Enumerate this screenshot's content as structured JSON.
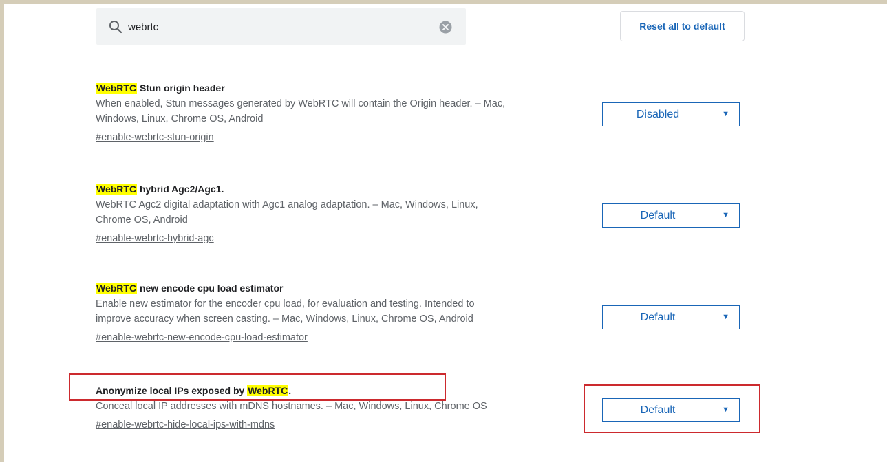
{
  "search": {
    "value": "webrtc",
    "icon": "search-icon",
    "clear_icon": "clear-icon"
  },
  "toolbar": {
    "reset_label": "Reset all to default"
  },
  "colors": {
    "accent": "#1a66b7",
    "highlight": "#ffff00",
    "annotation": "#cc2a2e"
  },
  "flags": [
    {
      "title_mark": "WebRTC",
      "title_rest": " Stun origin header",
      "desc_line1": "When enabled, Stun messages generated by WebRTC will contain the Origin header. – Mac,",
      "desc_line2": "Windows, Linux, Chrome OS, Android",
      "anchor": "#enable-webrtc-stun-origin",
      "selected": "Disabled"
    },
    {
      "title_mark": "WebRTC",
      "title_rest": " hybrid Agc2/Agc1.",
      "desc_line1": "WebRTC Agc2 digital adaptation with Agc1 analog adaptation. – Mac, Windows, Linux,",
      "desc_line2": "Chrome OS, Android",
      "anchor": "#enable-webrtc-hybrid-agc",
      "selected": "Default"
    },
    {
      "title_mark": "WebRTC",
      "title_rest": " new encode cpu load estimator",
      "desc_line1": "Enable new estimator for the encoder cpu load, for evaluation and testing. Intended to",
      "desc_line2": "improve accuracy when screen casting. – Mac, Windows, Linux, Chrome OS, Android",
      "anchor": "#enable-webrtc-new-encode-cpu-load-estimator",
      "selected": "Default"
    },
    {
      "title_pre": "Anonymize local IPs exposed by ",
      "title_mark": "WebRTC",
      "title_post": ".",
      "desc_line1": "Conceal local IP addresses with mDNS hostnames. – Mac, Windows, Linux, Chrome OS",
      "anchor": "#enable-webrtc-hide-local-ips-with-mdns",
      "selected": "Default"
    }
  ]
}
